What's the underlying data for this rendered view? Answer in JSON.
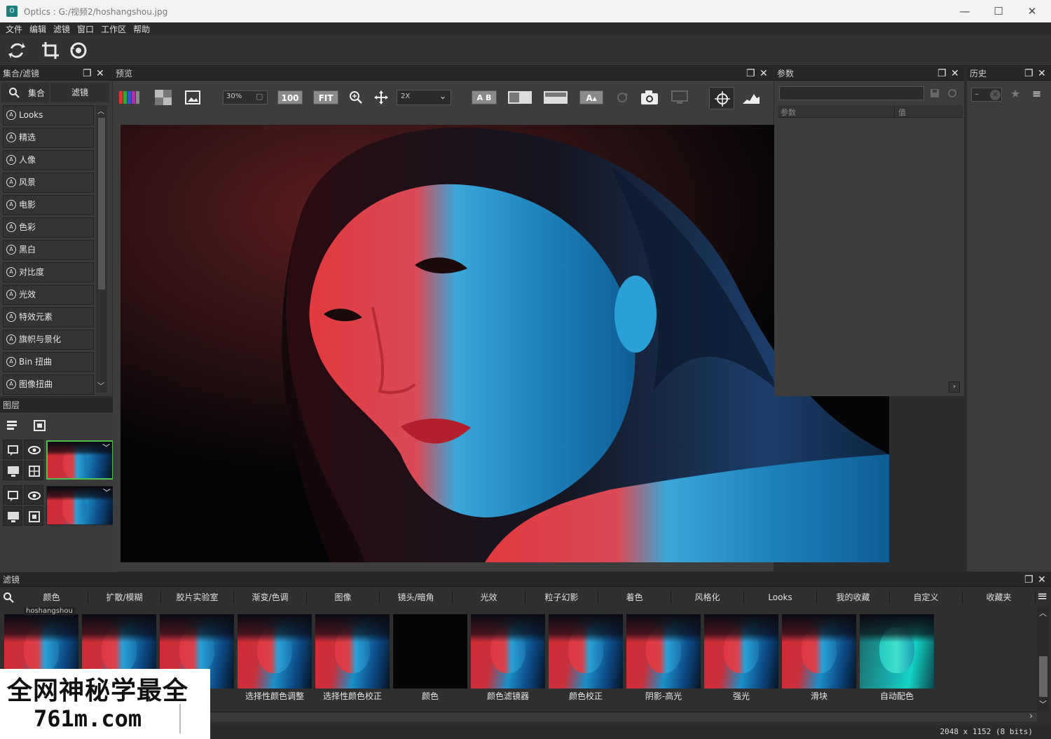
{
  "window": {
    "title": "Optics : G:/视频2/hoshangshou.jpg",
    "app_icon": "O",
    "minimize": "—",
    "maximize": "☐",
    "close": "✕"
  },
  "menu": [
    "文件",
    "编辑",
    "滤镜",
    "窗口",
    "工作区",
    "帮助"
  ],
  "left_panel": {
    "title": "集合/滤镜",
    "tab_collections": "集合",
    "tab_filters": "滤镜",
    "filters": [
      "Looks",
      "精选",
      "人像",
      "风景",
      "电影",
      "色彩",
      "黑白",
      "对比度",
      "光效",
      "特效元素",
      "旗帜与景化",
      "Bin 扭曲",
      "图像扭曲"
    ]
  },
  "layers_panel": {
    "title": "图层"
  },
  "view_panel": {
    "title": "预览",
    "zoom_value": "30%",
    "btn_100": "100",
    "btn_fit": "FIT",
    "dropdown_value": "2X",
    "btn_ab": "A B",
    "btn_a_text": "A"
  },
  "params_panel": {
    "title": "参数",
    "col_param": "参数",
    "col_value": "值"
  },
  "history_panel": {
    "title": "历史"
  },
  "gallery": {
    "title": "滤镜",
    "tabs": [
      "颜色",
      "扩散/模糊",
      "胶片实验室",
      "渐变/色调",
      "图像",
      "镜头/暗角",
      "光效",
      "粒子幻影",
      "着色",
      "风格化",
      "Looks",
      "我的收藏",
      "自定义",
      "收藏夹"
    ],
    "tooltip": "hoshangshou",
    "labels": [
      "",
      "",
      "",
      "选择性颜色调整",
      "选择性颜色校正",
      "颜色",
      "颜色滤镜器",
      "颜色校正",
      "阴影-高光",
      "强光",
      "滑块",
      "自动配色"
    ]
  },
  "status": {
    "image_info": "2048 x 1152 (8 bits)"
  },
  "watermark": {
    "line1": "全网神秘学最全",
    "line2": "761m.com"
  }
}
